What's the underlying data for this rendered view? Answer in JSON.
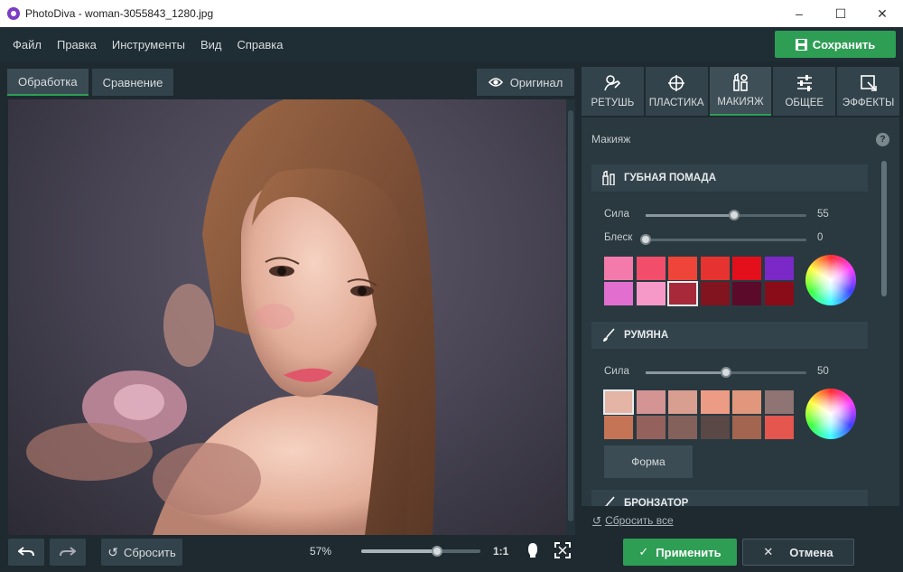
{
  "window": {
    "title": "PhotoDiva - woman-3055843_1280.jpg",
    "minimize_icon": "minimize-icon",
    "maximize_icon": "maximize-icon",
    "close_icon": "close-icon"
  },
  "menu": {
    "items": [
      "Файл",
      "Правка",
      "Инструменты",
      "Вид",
      "Справка"
    ],
    "save_label": "Сохранить"
  },
  "view_tabs": [
    {
      "label": "Обработка",
      "active": true
    },
    {
      "label": "Сравнение",
      "active": false
    }
  ],
  "original_label": "Оригинал",
  "bottom": {
    "reset_label": "Сбросить",
    "zoom_text": "57%",
    "zoom_value": 0.64,
    "one_to_one": "1:1"
  },
  "panel_tabs": [
    {
      "label": "РЕТУШЬ",
      "icon": "retouch-icon",
      "active": false
    },
    {
      "label": "ПЛАСТИКА",
      "icon": "plastic-icon",
      "active": false
    },
    {
      "label": "МАКИЯЖ",
      "icon": "makeup-icon",
      "active": true
    },
    {
      "label": "ОБЩЕЕ",
      "icon": "sliders-icon",
      "active": false
    },
    {
      "label": "ЭФФЕКТЫ",
      "icon": "effects-icon",
      "active": false
    }
  ],
  "panel": {
    "header": "Макияж",
    "help": "?",
    "lipstick": {
      "title": "ГУБНАЯ ПОМАДА",
      "strength_label": "Сила",
      "strength_value": "55",
      "strength": 55,
      "gloss_label": "Блеск",
      "gloss_value": "0",
      "gloss": 0,
      "colors": [
        "#f47aac",
        "#f24e6c",
        "#ee4538",
        "#e6332f",
        "#e3101c",
        "#7a28c8",
        "#e26fcf",
        "#f799c8",
        "#a82a3a",
        "#821420",
        "#5c0a2a",
        "#8a0c18"
      ],
      "selected": 8
    },
    "blush": {
      "title": "РУМЯНА",
      "strength_label": "Сила",
      "strength_value": "50",
      "strength": 50,
      "colors": [
        "#e4b4a4",
        "#d49494",
        "#d89e90",
        "#ec9c84",
        "#e0977c",
        "#8e7472",
        "#c57456",
        "#94615c",
        "#84615a",
        "#5a4846",
        "#a3654f",
        "#e4564e"
      ],
      "selected": 0,
      "shape_label": "Форма"
    },
    "bronzer": {
      "title": "БРОНЗАТОР"
    },
    "reset_all": "Сбросить все"
  },
  "actions": {
    "apply": "Применить",
    "cancel": "Отмена"
  },
  "colors": {
    "accent": "#2e9e55",
    "bg": "#1e2a30",
    "panel": "#2a3940"
  }
}
